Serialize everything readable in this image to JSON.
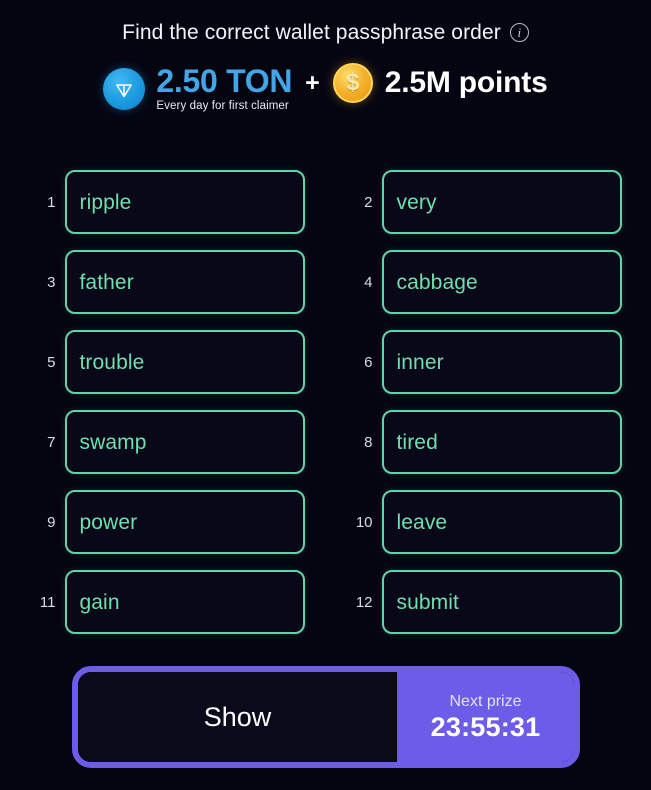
{
  "header": {
    "title": "Find the correct wallet passphrase order",
    "info_icon": "info-icon",
    "info_glyph": "i"
  },
  "prize": {
    "ton_icon": "ton-logo-icon",
    "ton_amount": "2.50 TON",
    "ton_subtitle": "Every day for first claimer",
    "plus": "+",
    "coin_icon": "gold-coin-icon",
    "coin_glyph": "$",
    "points_amount": "2.5M points",
    "ton_color": "#41a6e8",
    "coin_color": "#f5b22c"
  },
  "grid": {
    "tiles": [
      {
        "num": "1",
        "word": "ripple"
      },
      {
        "num": "2",
        "word": "very"
      },
      {
        "num": "3",
        "word": "father"
      },
      {
        "num": "4",
        "word": "cabbage"
      },
      {
        "num": "5",
        "word": "trouble"
      },
      {
        "num": "6",
        "word": "inner"
      },
      {
        "num": "7",
        "word": "swamp"
      },
      {
        "num": "8",
        "word": "tired"
      },
      {
        "num": "9",
        "word": "power"
      },
      {
        "num": "10",
        "word": "leave"
      },
      {
        "num": "11",
        "word": "gain"
      },
      {
        "num": "12",
        "word": "submit"
      }
    ],
    "tile_border_color": "#5fd6a4",
    "tile_text_color": "#6fe0ad"
  },
  "action_bar": {
    "show_label": "Show",
    "prize_label": "Next prize",
    "timer": "23:55:31",
    "accent_color": "#6c5ce7"
  }
}
